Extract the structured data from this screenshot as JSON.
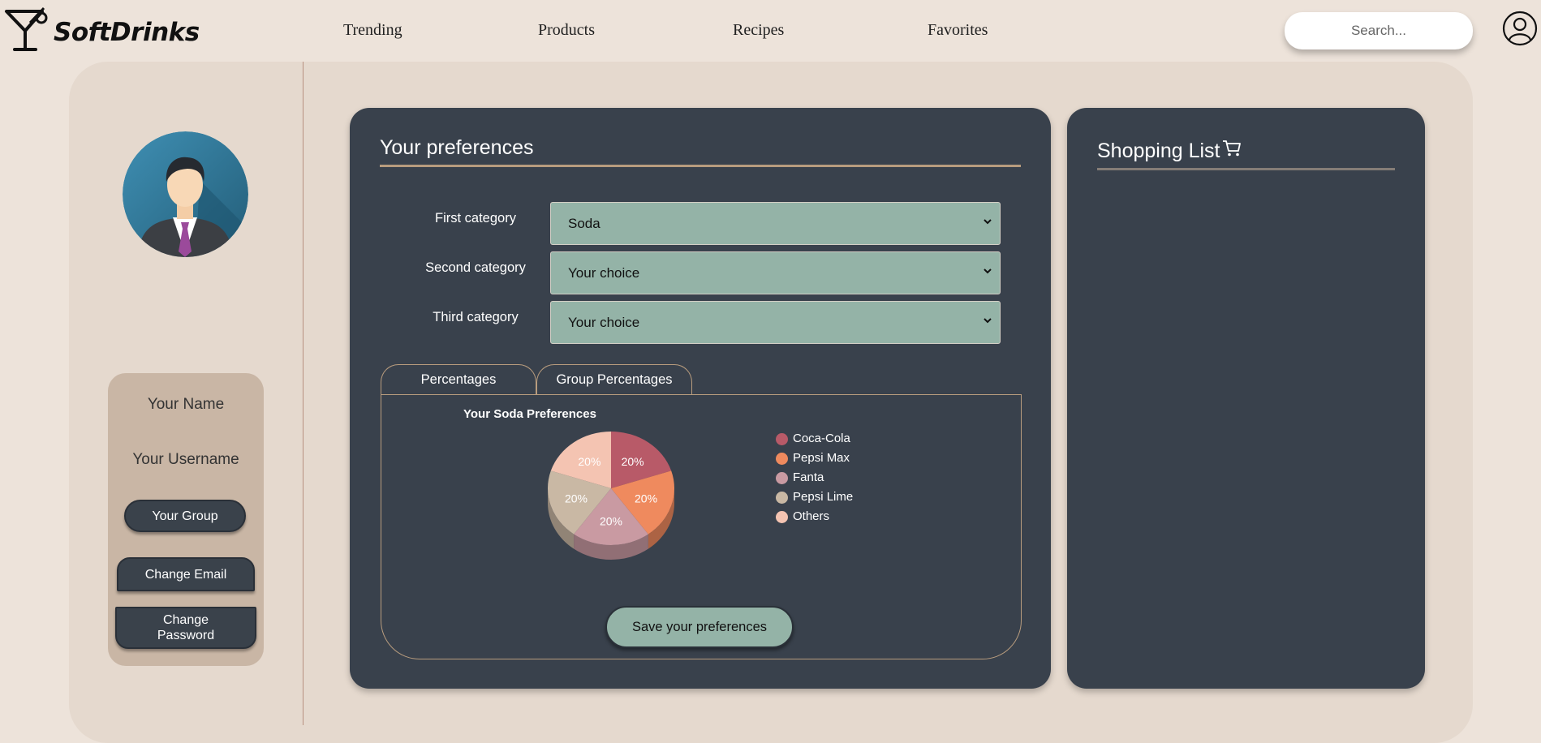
{
  "brand": {
    "name": "SoftDrinks"
  },
  "nav": {
    "links": [
      "Trending",
      "Products",
      "Recipes",
      "Favorites"
    ],
    "search_placeholder": "Search..."
  },
  "profile": {
    "name": "Your Name",
    "username": "Your Username",
    "group_label": "Your Group",
    "change_email_label": "Change Email",
    "change_password_label": "Change Password"
  },
  "preferences": {
    "title": "Your preferences",
    "categories": [
      {
        "label": "First category",
        "value": "Soda"
      },
      {
        "label": "Second category",
        "value": "Your choice"
      },
      {
        "label": "Third category",
        "value": "Your choice"
      }
    ],
    "tabs": [
      "Percentages",
      "Group Percentages"
    ],
    "save_label": "Save your preferences"
  },
  "chart_data": {
    "type": "pie",
    "title": "Your Soda Preferences",
    "categories": [
      "Coca-Cola",
      "Pepsi Max",
      "Fanta",
      "Pepsi Lime",
      "Others"
    ],
    "values": [
      20,
      20,
      20,
      20,
      20
    ],
    "labels": [
      "20%",
      "20%",
      "20%",
      "20%",
      "20%"
    ],
    "colors": [
      "#b85a68",
      "#ef8a5e",
      "#c99aa2",
      "#c9b8a4",
      "#f4c4b2"
    ],
    "legend_position": "right"
  },
  "shopping": {
    "title": "Shopping List"
  },
  "colors": {
    "background": "#ede3da",
    "panel": "#e5d9ce",
    "card": "#39414c",
    "select": "#94b3a7",
    "accent_line": "#b89c7e"
  }
}
